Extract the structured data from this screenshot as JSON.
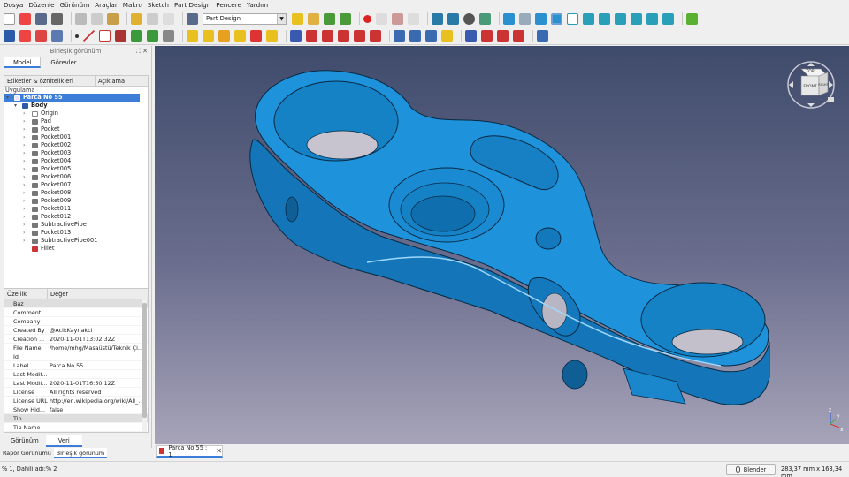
{
  "menu": [
    "Dosya",
    "Düzenle",
    "Görünüm",
    "Araçlar",
    "Makro",
    "Sketch",
    "Part Design",
    "Pencere",
    "Yardım"
  ],
  "toolbar": {
    "workbench": "Part Design"
  },
  "combo_view": {
    "title": "Birleşik görünüm",
    "tabs": [
      "Model",
      "Görevler"
    ],
    "tree_headers": [
      "Etiketler & öznitelikleri",
      "Açıklama"
    ],
    "section": "Uygulama",
    "root": "Parca No 55",
    "body": "Body",
    "items": [
      "Origin",
      "Pad",
      "Pocket",
      "Pocket001",
      "Pocket002",
      "Pocket003",
      "Pocket004",
      "Pocket005",
      "Pocket006",
      "Pocket007",
      "Pocket008",
      "Pocket009",
      "Pocket011",
      "Pocket012",
      "SubtractivePipe",
      "Pocket013",
      "SubtractivePipe001",
      "Fillet"
    ],
    "splitter": "-----",
    "prop_headers": [
      "Özellik",
      "Değer"
    ],
    "properties": [
      {
        "k": "Baz",
        "v": "",
        "group": true
      },
      {
        "k": "Comment",
        "v": ""
      },
      {
        "k": "Company",
        "v": ""
      },
      {
        "k": "Created By",
        "v": "@AcikKaynakci"
      },
      {
        "k": "Creation ...",
        "v": "2020-11-01T13:02:32Z"
      },
      {
        "k": "File Name",
        "v": "/home/mhg/Masaüstü/Teknik Çi..."
      },
      {
        "k": "Id",
        "v": ""
      },
      {
        "k": "Label",
        "v": "Parca No 55"
      },
      {
        "k": "Last Modif...",
        "v": ""
      },
      {
        "k": "Last Modif...",
        "v": "2020-11-01T16:50:12Z"
      },
      {
        "k": "License",
        "v": "All rights reserved"
      },
      {
        "k": "License URL",
        "v": "http://en.wikipedia.org/wiki/All_..."
      },
      {
        "k": "Show Hid...",
        "v": "false"
      },
      {
        "k": "Tip",
        "v": "",
        "group": true
      },
      {
        "k": "Tip Name",
        "v": ""
      }
    ],
    "bottom_tabs": [
      "Görünüm",
      "Veri"
    ]
  },
  "document_tab": "Parca No 55 : 1",
  "report_tabs": [
    "Rapor Görünümü",
    "Birleşik görünüm"
  ],
  "status": {
    "message": "% 1, Dahili adı:% 2",
    "navigation": "Blender",
    "dimensions": "283,37 mm x 163,34 mm"
  },
  "navcube": {
    "faces": [
      "TOP",
      "FRONT",
      "RIGHT"
    ]
  },
  "axes": [
    "x",
    "y",
    "z"
  ],
  "colors": {
    "part": "#1c8fd8",
    "selection": "#3d7ed9",
    "background_top": "#3f4b6b",
    "background_bottom": "#a7a4b9"
  }
}
